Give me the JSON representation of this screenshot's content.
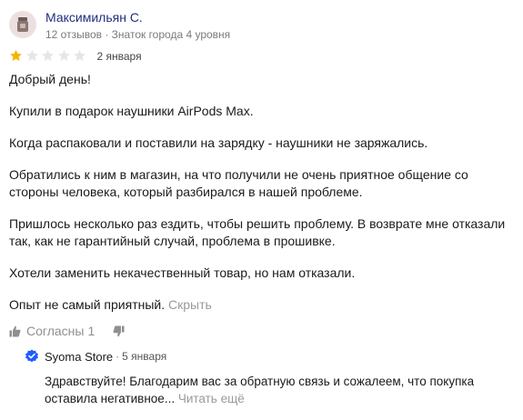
{
  "review": {
    "author": {
      "name": "Максимильян С.",
      "meta": "12 отзывов · Знаток города 4 уровня"
    },
    "rating": {
      "value": 1,
      "max": 5
    },
    "date": "2 января",
    "paragraphs": [
      "Добрый день!",
      "Купили в подарок наушники AirPods Max.",
      "Когда распаковали и поставили на зарядку - наушники не заряжались.",
      "Обратились к ним в магазин, на что получили не очень приятное общение со стороны человека, который разбирался в нашей проблеме.",
      "Пришлось несколько раз ездить, чтобы решить проблему. В возврате мне отказали так, как не гарантийный случай, проблема в прошивке.",
      "Хотели заменить некачественный товар, но нам отказали."
    ],
    "last_paragraph": "Опыт не самый приятный.",
    "hide_label": "Скрыть",
    "actions": {
      "agree_label": "Согласны",
      "agree_count": "1"
    }
  },
  "reply": {
    "org_name": "Syoma Store",
    "separator": "·",
    "date": "5 января",
    "text": "Здравствуйте! Благодарим вас за обратную связь и сожалеем, что покупка оставила негативное...",
    "read_more": "Читать ещё"
  },
  "colors": {
    "star_filled": "#f5b400",
    "star_empty": "#e6e6e6",
    "verified_badge": "#1d5cff",
    "author_link": "#1f2f7d"
  },
  "icons": [
    "user-avatar",
    "star-icon",
    "thumbs-up-icon",
    "thumbs-down-icon",
    "verified-badge-icon"
  ]
}
